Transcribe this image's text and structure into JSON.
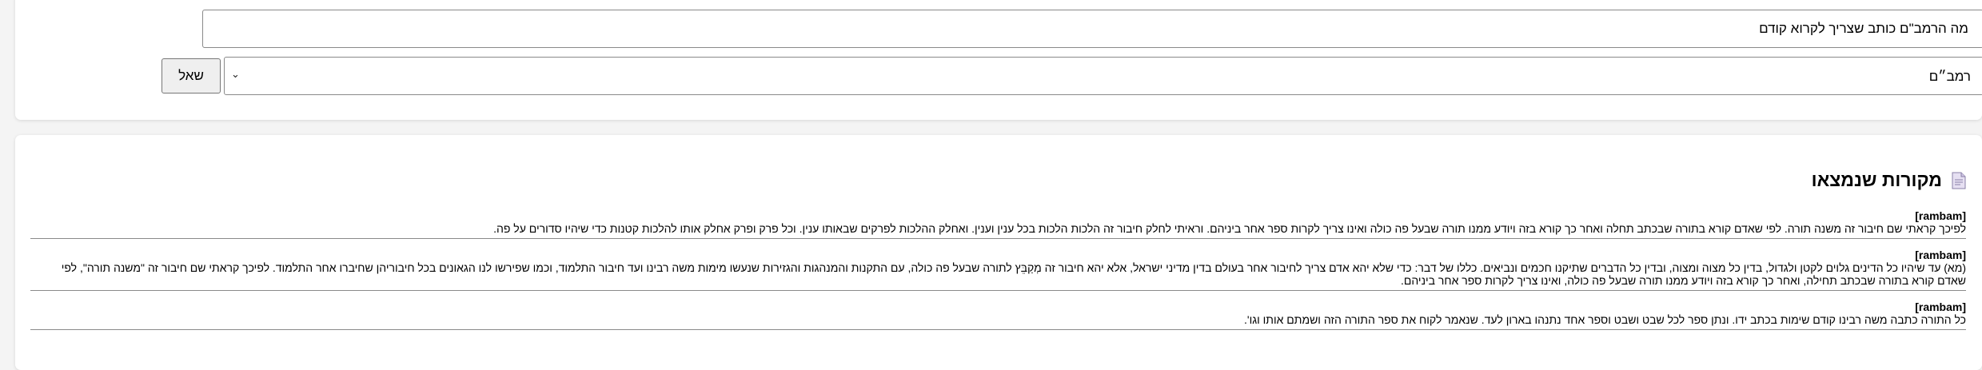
{
  "query": {
    "value": "מה הרמב\"ם כותב שצריך לקרוא קודם",
    "placeholder": ""
  },
  "source_select": {
    "selected": "רמב״ם",
    "chevron_icon": "chevron-down-icon"
  },
  "ask_button": {
    "label": "שאל"
  },
  "results": {
    "title": "מקורות שנמצאו",
    "icon": "document-icon",
    "items": [
      {
        "source": "[rambam]",
        "text": "לפיכך קראתי שם חיבור זה משנה תורה. לפי שאדם קורא בתורה שבכתב תחלה ואחר כך קורא בזה ויודע ממנו תורה שבעל פה כולה ואינו צריך לקרות ספר אחר ביניהם. וראיתי לחלק חיבור זה הלכות הלכות בכל ענין וענין. ואחלק ההלכות לפרקים שבאותו ענין. וכל פרק ופרק אחלק אותו להלכות קטנות כדי שיהיו סדורים על פה."
      },
      {
        "source": "[rambam]",
        "text": "(מא) עד שיהיו כל הדינים גלוים לקטן ולגדול, בדין כל מצוה ומצוה, ובדין כל הדברים שתיקנו חכמים ונביאים. כללו של דבר: כדי שלא יהא אדם צריך לחיבור אחר בעולם בדין מדיני ישראל, אלא יהא חיבור זה מְקַבֵּץ לתורה שבעל פה כולה, עם התקנות והמנהגות והגזירות שנעשו מימות משה רבינו ועד חיבור התלמוד, וכמו שפירשו לנו הגאונים בכל חיבוריהן שחיברו אחר התלמוד. לפיכך קראתי שם חיבור זה \"משנה תורה\", לפי שאדם קורא בתורה שבכתב תחילה, ואחר כך קורא בזה ויודע ממנו תורה שבעל פה כולה, ואינו צריך לקרות ספר אחר ביניהם."
      },
      {
        "source": "[rambam]",
        "text": "כל התורה כתבה משה רבינו קודם שימות בכתב ידו. ונתן ספר לכל שבט ושבט וספר אחד נתנהו בארון לעד. שנאמר לקוח את ספר התורה הזה ושמתם אותו וגו'."
      }
    ]
  }
}
